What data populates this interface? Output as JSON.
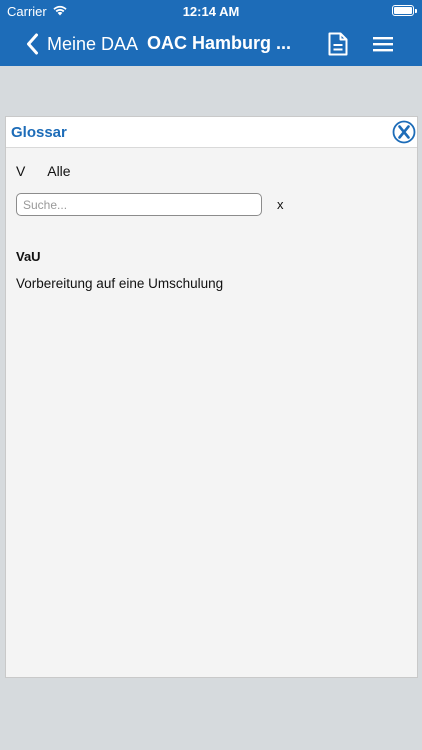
{
  "status_bar": {
    "carrier": "Carrier",
    "time": "12:14 AM"
  },
  "nav": {
    "back_label": "Meine DAA",
    "title": "OAC Hamburg ...",
    "icons": [
      "chevron-left-icon",
      "document-icon",
      "menu-icon"
    ]
  },
  "glossary": {
    "title": "Glossar",
    "letter": "V",
    "all_label": "Alle",
    "search_placeholder": "Suche...",
    "clear_label": "x",
    "entries": [
      {
        "term": "VaU",
        "definition": "Vorbereitung auf eine Umschulung"
      }
    ]
  },
  "colors": {
    "brand": "#1d6cb8",
    "background": "#d6dadd",
    "panel": "#f4f4f4"
  }
}
